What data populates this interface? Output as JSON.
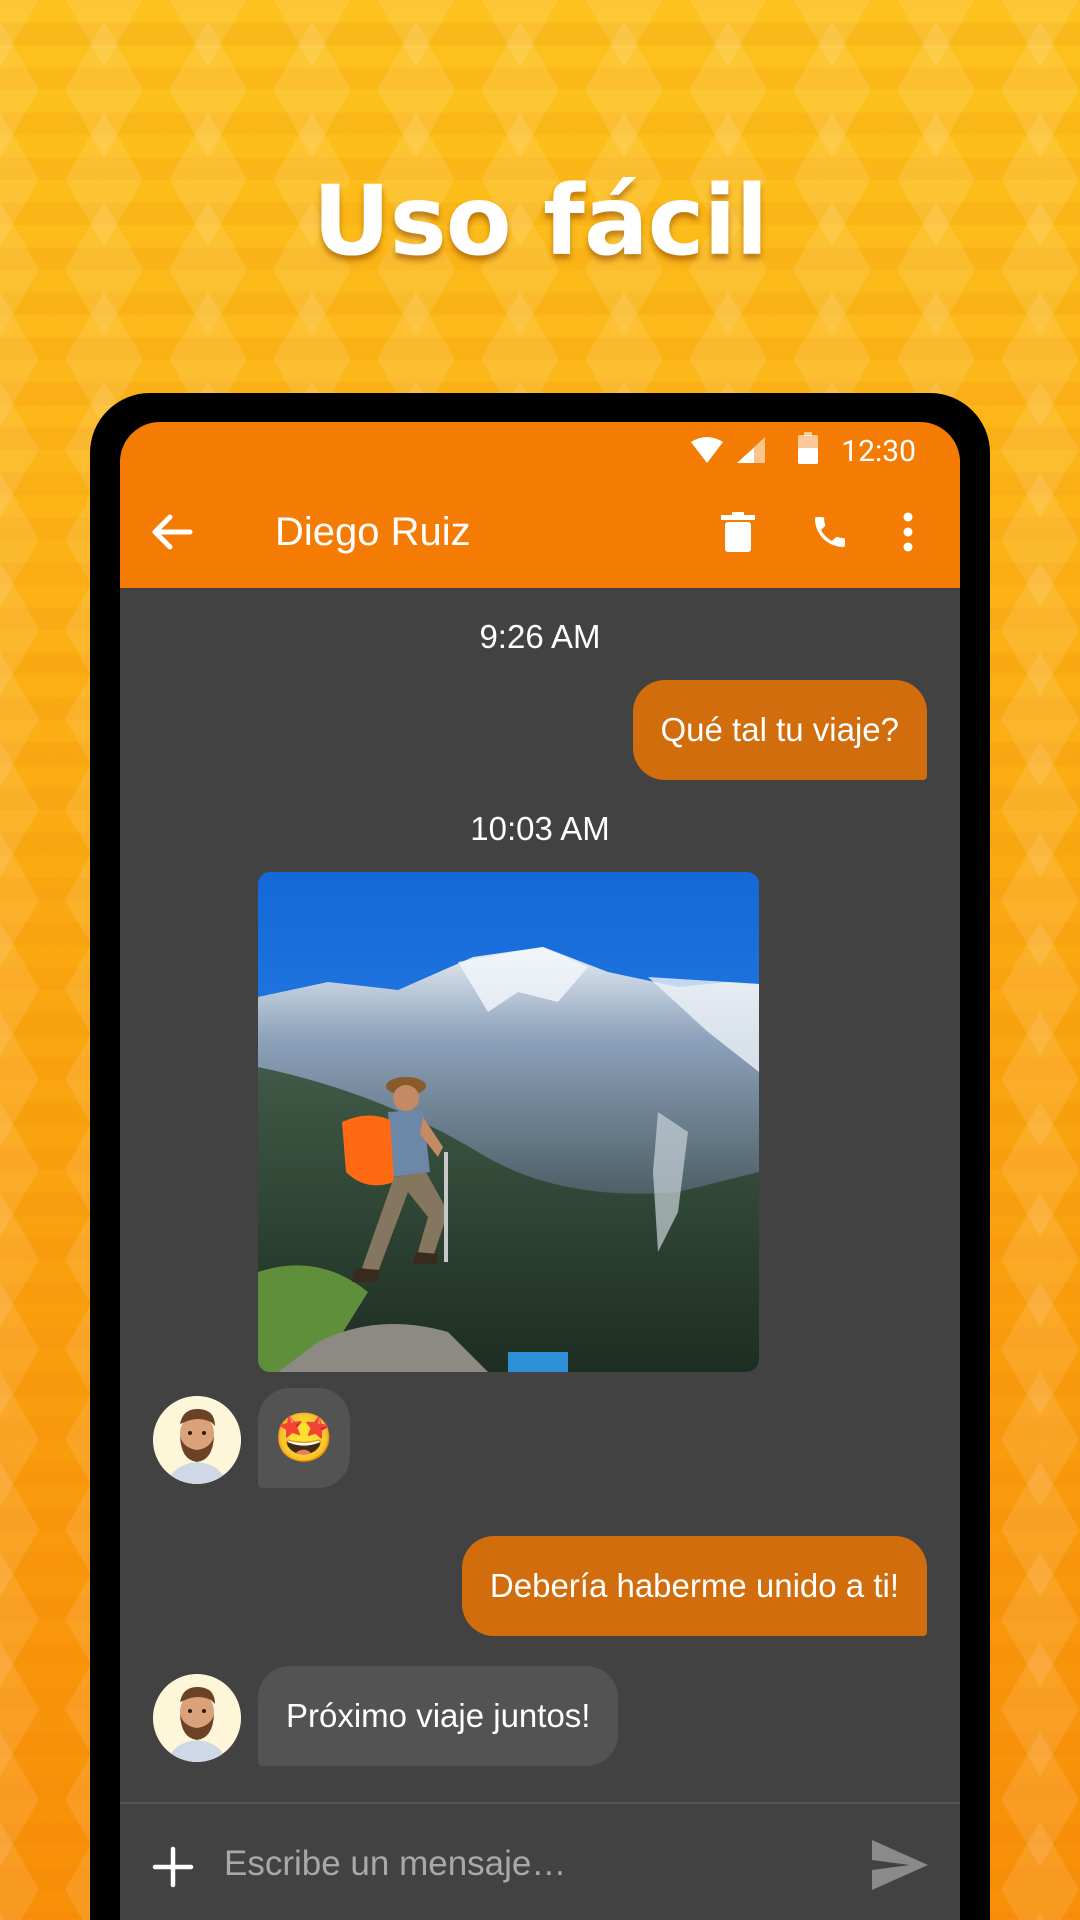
{
  "headline": "Uso fácil",
  "status_bar": {
    "time": "12:30"
  },
  "toolbar": {
    "contact_name": "Diego Ruiz"
  },
  "messages": [
    {
      "type": "timestamp",
      "text": "9:26 AM"
    },
    {
      "type": "outgoing",
      "text": "Qué tal tu viaje?"
    },
    {
      "type": "timestamp",
      "text": "10:03 AM"
    },
    {
      "type": "incoming-image"
    },
    {
      "type": "incoming",
      "text": "🤩"
    },
    {
      "type": "outgoing",
      "text": "Debería haberme unido a ti!"
    },
    {
      "type": "incoming",
      "text": "Próximo viaje juntos!"
    }
  ],
  "composer": {
    "placeholder": "Escribe un mensaje…"
  },
  "colors": {
    "accent": "#f57c04",
    "outgoing_bubble": "#d26d0d",
    "incoming_bubble": "#535353",
    "chat_background": "#424242"
  },
  "icons": [
    "back-arrow-icon",
    "trash-icon",
    "phone-icon",
    "more-vert-icon",
    "wifi-icon",
    "signal-icon",
    "battery-icon",
    "add-icon",
    "send-icon"
  ]
}
